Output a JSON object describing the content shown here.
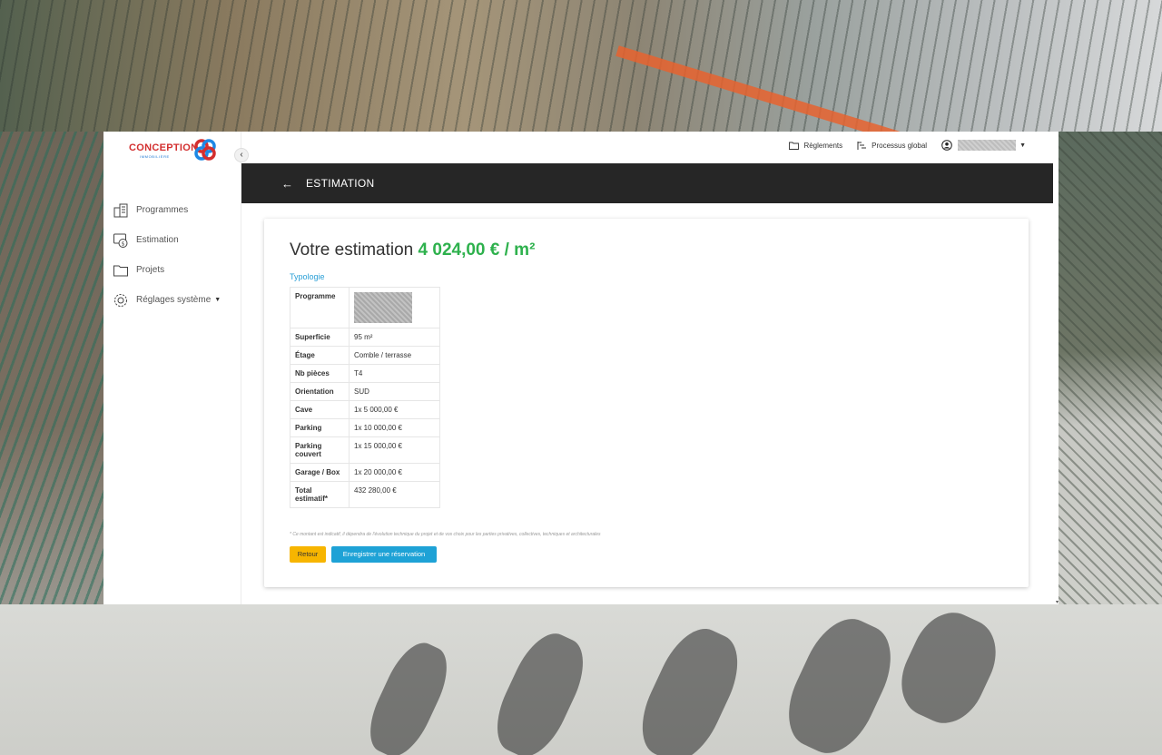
{
  "brand": {
    "name": "CONCEPTION",
    "tagline": "IMMOBILIÈRE"
  },
  "sidebar": {
    "items": [
      {
        "label": "Programmes",
        "icon": "building-icon"
      },
      {
        "label": "Estimation",
        "icon": "estimate-icon"
      },
      {
        "label": "Projets",
        "icon": "folder-icon"
      },
      {
        "label": "Réglages système",
        "icon": "gear-icon"
      }
    ]
  },
  "topbar": {
    "reglements": "Règlements",
    "processus": "Processus global",
    "user_name": ""
  },
  "header": {
    "title": "ESTIMATION"
  },
  "estimation": {
    "title_prefix": "Votre estimation",
    "value": "4 024,00 € / m²",
    "typology_label": "Typologie",
    "rows": [
      {
        "key": "Programme",
        "value": ""
      },
      {
        "key": "Superficie",
        "value": "95 m²"
      },
      {
        "key": "Étage",
        "value": "Comble / terrasse"
      },
      {
        "key": "Nb pièces",
        "value": "T4"
      },
      {
        "key": "Orientation",
        "value": "SUD"
      },
      {
        "key": "Cave",
        "value": "1x 5 000,00 €"
      },
      {
        "key": "Parking",
        "value": "1x 10 000,00 €"
      },
      {
        "key": "Parking couvert",
        "value": "1x 15 000,00 €"
      },
      {
        "key": "Garage / Box",
        "value": "1x 20 000,00 €"
      },
      {
        "key": "Total estimatif*",
        "value": "432 280,00 €"
      }
    ],
    "note": "* Ce montant est indicatif, il dépendra de l'évolution technique du projet et de vos choix pour les parties privatives, collectives, techniques et architecturales",
    "btn_back": "Retour",
    "btn_save": "Enregistrer une réservation"
  },
  "colors": {
    "accent_green": "#2eb14d",
    "accent_blue": "#1ea2d6",
    "accent_yellow": "#f7b500",
    "header_dark": "#262626"
  }
}
